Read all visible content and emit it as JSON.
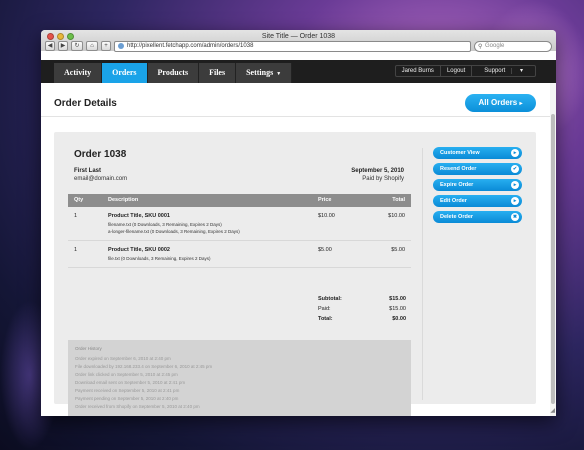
{
  "window": {
    "title": "Site Title — Order 1038"
  },
  "browser": {
    "url": "http://pixellent.fetchapp.com/admin/orders/1038",
    "search_placeholder": "Google"
  },
  "nav": {
    "tabs": [
      "Activity",
      "Orders",
      "Products",
      "Files",
      "Settings"
    ],
    "active": "Orders",
    "user": "Jared Burns",
    "logout": "Logout",
    "support": "Support"
  },
  "page": {
    "title": "Order Details",
    "all_orders": "All Orders"
  },
  "order": {
    "number": "Order 1038",
    "customer_name": "First Last",
    "customer_email": "email@domain.com",
    "date": "September 5, 2010",
    "paid_by": "Paid by Shopify",
    "columns": [
      "Qty",
      "Description",
      "Price",
      "Total"
    ],
    "items": [
      {
        "qty": "1",
        "title": "Product Title, SKU 0001",
        "files": [
          "filename.txt  (0 Downloads, 3 Remaining, Expires 2 Days)",
          "a-longer-filename.txt  (0 Downloads, 3 Remaining, Expires 2 Days)"
        ],
        "price": "$10.00",
        "total": "$10.00"
      },
      {
        "qty": "1",
        "title": "Product Title, SKU 0002",
        "files": [
          "file.txt  (0 Downloads, 3 Remaining, Expires 2 Days)"
        ],
        "price": "$5.00",
        "total": "$5.00"
      }
    ],
    "summary": {
      "subtotal_label": "Subtotal:",
      "subtotal": "$15.00",
      "paid_label": "Paid:",
      "paid": "$15.00",
      "total_label": "Total:",
      "total": "$0.00"
    },
    "history_title": "Order History",
    "history": [
      "Order expired on September 6, 2010 at 2:40 pm",
      "File downloaded by 192.168.233.4 on September 6, 2010 at 2:45 pm",
      "Order link clicked on September 5, 2010 at 2:45 pm",
      "Download email sent on September 5, 2010 at 2:41 pm",
      "Payment received on September 5, 2010 at 2:41 pm",
      "Payment pending on September 5, 2010 at 2:40 pm",
      "Order received from Shopify on September 5, 2010 at 2:40 pm"
    ]
  },
  "actions": [
    {
      "label": "Customer View",
      "icon": "chevron-right-icon",
      "glyph": "▸"
    },
    {
      "label": "Resend Order",
      "icon": "check-icon",
      "glyph": "✔"
    },
    {
      "label": "Expire Order",
      "icon": "chevron-right-icon",
      "glyph": "▸"
    },
    {
      "label": "Edit Order",
      "icon": "chevron-right-icon",
      "glyph": "▸"
    },
    {
      "label": "Delete Order",
      "icon": "close-icon",
      "glyph": "✖"
    }
  ],
  "colors": {
    "accent": "#1aa3e8",
    "navbar": "#1e1e1e",
    "table_header": "#8d8d8d"
  }
}
